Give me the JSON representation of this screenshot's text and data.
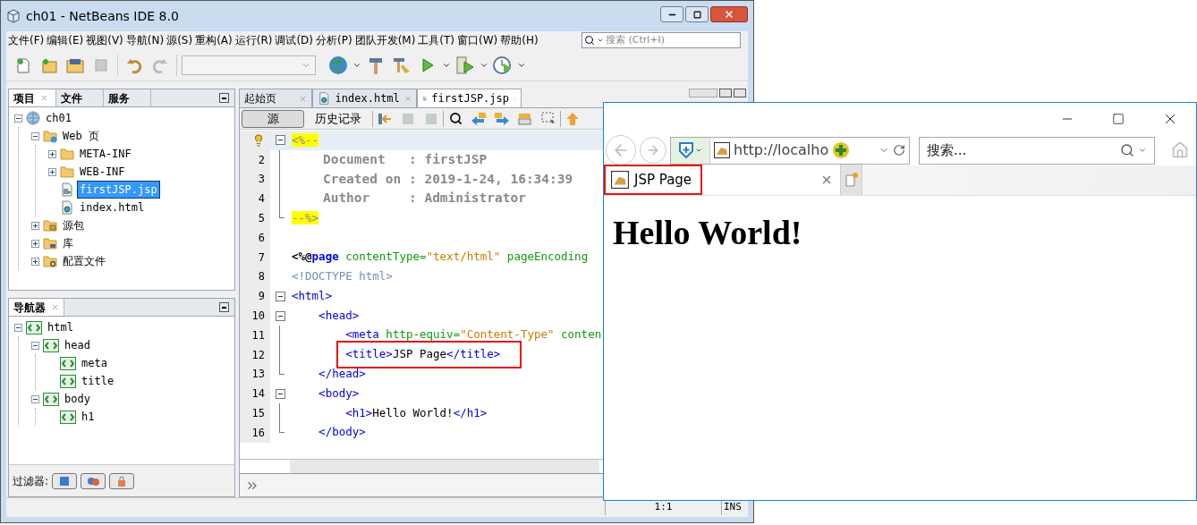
{
  "window": {
    "title": "ch01 - NetBeans IDE 8.0"
  },
  "menu": [
    "文件(F)",
    "编辑(E)",
    "视图(V)",
    "导航(N)",
    "源(S)",
    "重构(A)",
    "运行(R)",
    "调试(D)",
    "分析(P)",
    "团队开发(M)",
    "工具(T)",
    "窗口(W)",
    "帮助(H)"
  ],
  "search": {
    "placeholder": "搜索 (Ctrl+I)"
  },
  "project_panel": {
    "tabs": [
      {
        "label": "项目",
        "selected": true
      },
      {
        "label": "文件",
        "selected": false
      },
      {
        "label": "服务",
        "selected": false
      }
    ],
    "tree": [
      {
        "label": "ch01",
        "kind": "project",
        "expanded": true,
        "selected": false,
        "children": [
          {
            "label": "Web 页",
            "kind": "webfolder",
            "expanded": true,
            "selected": false,
            "children": [
              {
                "label": "META-INF",
                "kind": "folder",
                "expanded": false,
                "selected": false
              },
              {
                "label": "WEB-INF",
                "kind": "folder",
                "expanded": false,
                "selected": false
              },
              {
                "label": "firstJSP.jsp",
                "kind": "jsp",
                "selected": true
              },
              {
                "label": "index.html",
                "kind": "html",
                "selected": false
              }
            ]
          },
          {
            "label": "源包",
            "kind": "srcpkg",
            "expanded": false,
            "selected": false
          },
          {
            "label": "库",
            "kind": "lib",
            "expanded": false,
            "selected": false
          },
          {
            "label": "配置文件",
            "kind": "config",
            "expanded": false,
            "selected": false
          }
        ]
      }
    ]
  },
  "navigator": {
    "title": "导航器",
    "tree": [
      {
        "label": "html",
        "kind": "tag",
        "expanded": true,
        "selected": false,
        "children": [
          {
            "label": "head",
            "kind": "tag",
            "expanded": true,
            "selected": false,
            "children": [
              {
                "label": "meta",
                "kind": "tag",
                "selected": false
              },
              {
                "label": "title",
                "kind": "tag",
                "selected": false
              }
            ]
          },
          {
            "label": "body",
            "kind": "tag",
            "expanded": true,
            "selected": false,
            "children": [
              {
                "label": "h1",
                "kind": "tag",
                "selected": false
              }
            ]
          }
        ]
      }
    ],
    "filter_label": "过滤器:"
  },
  "editor_tabs": [
    {
      "label": "起始页",
      "selected": false
    },
    {
      "label": "index.html",
      "kind": "html",
      "selected": false
    },
    {
      "label": "firstJSP.jsp",
      "kind": "jsp",
      "selected": true
    }
  ],
  "editor_views": [
    {
      "label": "源",
      "selected": true
    },
    {
      "label": "历史记录",
      "selected": false
    }
  ],
  "code": [
    {
      "kind": "fold-start",
      "current": true,
      "highlighted": false,
      "tokens": [
        {
          "text": "<%--",
          "kind": "delim"
        }
      ]
    },
    {
      "number": "2",
      "kind": "fold-inner",
      "current": false,
      "highlighted": false,
      "tokens": [
        {
          "text": "    Document   : firstJSP",
          "kind": "comment"
        }
      ]
    },
    {
      "number": "3",
      "kind": "fold-inner",
      "current": false,
      "highlighted": false,
      "tokens": [
        {
          "text": "    Created on : 2019-1-24, 16:34:39",
          "kind": "comment"
        }
      ]
    },
    {
      "number": "4",
      "kind": "fold-inner",
      "current": false,
      "highlighted": false,
      "tokens": [
        {
          "text": "    Author     : Administrator",
          "kind": "comment"
        }
      ]
    },
    {
      "number": "5",
      "kind": "fold-end",
      "current": false,
      "highlighted": false,
      "tokens": [
        {
          "text": "--%>",
          "kind": "delim"
        }
      ]
    },
    {
      "number": "6",
      "kind": "plain",
      "current": false
    },
    {
      "number": "7",
      "kind": "plain",
      "current": false,
      "highlighted": false,
      "tokens": [
        {
          "text": "<%@",
          "kind": "directive"
        },
        {
          "text": "page",
          "kind": "keyword"
        },
        {
          "text": " contentType=",
          "kind": "attr"
        },
        {
          "text": "\"text/html\"",
          "kind": "string"
        },
        {
          "text": " pageEncoding",
          "kind": "attr"
        }
      ]
    },
    {
      "number": "8",
      "kind": "plain",
      "current": false,
      "highlighted": false,
      "tokens": [
        {
          "text": "<!DOCTYPE html>",
          "kind": "doctype"
        }
      ]
    },
    {
      "number": "9",
      "kind": "fold-start",
      "current": false,
      "highlighted": false,
      "tokens": [
        {
          "text": "<html>",
          "kind": "tag"
        }
      ]
    },
    {
      "number": "10",
      "kind": "fold-start",
      "current": false,
      "highlighted": false,
      "tokens": [
        {
          "text": "    <head>",
          "kind": "tag"
        }
      ]
    },
    {
      "number": "11",
      "kind": "fold-inner",
      "current": false,
      "highlighted": false,
      "tokens": [
        {
          "text": "        <meta",
          "kind": "tag"
        },
        {
          "text": " http-equiv=",
          "kind": "attr"
        },
        {
          "text": "\"Content-Type\"",
          "kind": "string"
        },
        {
          "text": " conten",
          "kind": "attr"
        }
      ]
    },
    {
      "number": "12",
      "kind": "fold-inner",
      "current": false,
      "highlighted": true,
      "tokens": [
        {
          "text": "        <title>",
          "kind": "tag"
        },
        {
          "text": "JSP Page",
          "kind": "text"
        },
        {
          "text": "</title>",
          "kind": "tag"
        }
      ]
    },
    {
      "number": "13",
      "kind": "fold-end",
      "current": false,
      "highlighted": false,
      "tokens": [
        {
          "text": "    </head>",
          "kind": "tag"
        }
      ]
    },
    {
      "number": "14",
      "kind": "fold-start",
      "current": false,
      "highlighted": false,
      "tokens": [
        {
          "text": "    <body>",
          "kind": "tag"
        }
      ]
    },
    {
      "number": "15",
      "kind": "fold-inner",
      "current": false,
      "highlighted": false,
      "tokens": [
        {
          "text": "        <h1>",
          "kind": "tag"
        },
        {
          "text": "Hello World!",
          "kind": "text"
        },
        {
          "text": "</h1>",
          "kind": "tag"
        }
      ]
    },
    {
      "number": "16",
      "kind": "fold-end",
      "current": false,
      "highlighted": false,
      "tokens": [
        {
          "text": "    </body>",
          "kind": "tag"
        }
      ]
    }
  ],
  "status_bar": {
    "position": "1:1",
    "mode": "INS"
  },
  "browser": {
    "address": "http://localho",
    "search_placeholder": "搜索...",
    "tabs": [
      {
        "label": "JSP Page",
        "selected": true,
        "highlighted": true
      }
    ],
    "heading": "Hello World!"
  }
}
